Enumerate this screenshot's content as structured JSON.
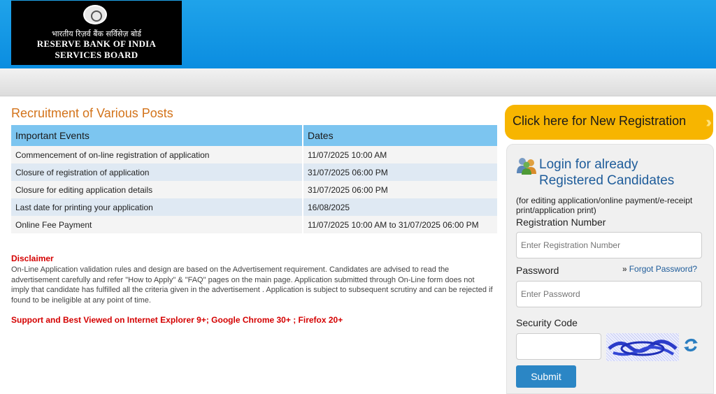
{
  "header": {
    "org_hindi": "भारतीय रिज़र्व बैंक सर्विसेज़ बोर्ड",
    "org_en_line1": "RESERVE BANK OF INDIA",
    "org_en_line2": "SERVICES BOARD"
  },
  "main": {
    "title": "Recruitment of Various Posts",
    "table": {
      "headers": [
        "Important Events",
        "Dates"
      ],
      "rows": [
        [
          "Commencement of on-line registration of application",
          "11/07/2025 10:00 AM"
        ],
        [
          "Closure of registration of application",
          "31/07/2025 06:00 PM"
        ],
        [
          "Closure for editing application details",
          "31/07/2025 06:00 PM"
        ],
        [
          "Last date for printing your application",
          "16/08/2025"
        ],
        [
          "Online Fee Payment",
          "11/07/2025 10:00 AM to 31/07/2025 06:00 PM"
        ]
      ]
    },
    "disclaimer_title": "Disclaimer",
    "disclaimer_text": "On-Line Application validation rules and design are based on the Advertisement requirement. Candidates are advised to read the advertisement carefully and refer \"How to Apply\" & \"FAQ\" pages on the main page. Application submitted through On-Line form does not imply that candidate has fulfilled all the criteria given in the advertisement . Application is subject to subsequent scrutiny and can be rejected if found to be ineligible at any point of time.",
    "support_text": "Support and Best Viewed on Internet Explorer 9+; Google Chrome 30+ ; Firefox 20+"
  },
  "sidebar": {
    "new_registration_label": "Click here for New Registration",
    "login_title_line1": "Login for already",
    "login_title_line2": "Registered Candidates",
    "login_subtitle": "(for editing application/online payment/e-receipt print/application print)",
    "registration_label": "Registration Number",
    "registration_placeholder": "Enter Registration Number",
    "password_label": "Password",
    "password_placeholder": "Enter Password",
    "forgot_password_label": "Forgot Password?",
    "security_code_label": "Security Code",
    "submit_label": "Submit"
  },
  "colors": {
    "header_blue": "#0b8de0",
    "title_orange": "#d3731a",
    "table_header": "#7cc5f0",
    "disclaimer_red": "#d40000",
    "register_button": "#f7b500",
    "login_blue": "#1e5c9a",
    "submit_button": "#2b86c5"
  },
  "icons": [
    "rbi-emblem-icon",
    "double-chevron-right-icon",
    "users-icon",
    "refresh-icon"
  ]
}
